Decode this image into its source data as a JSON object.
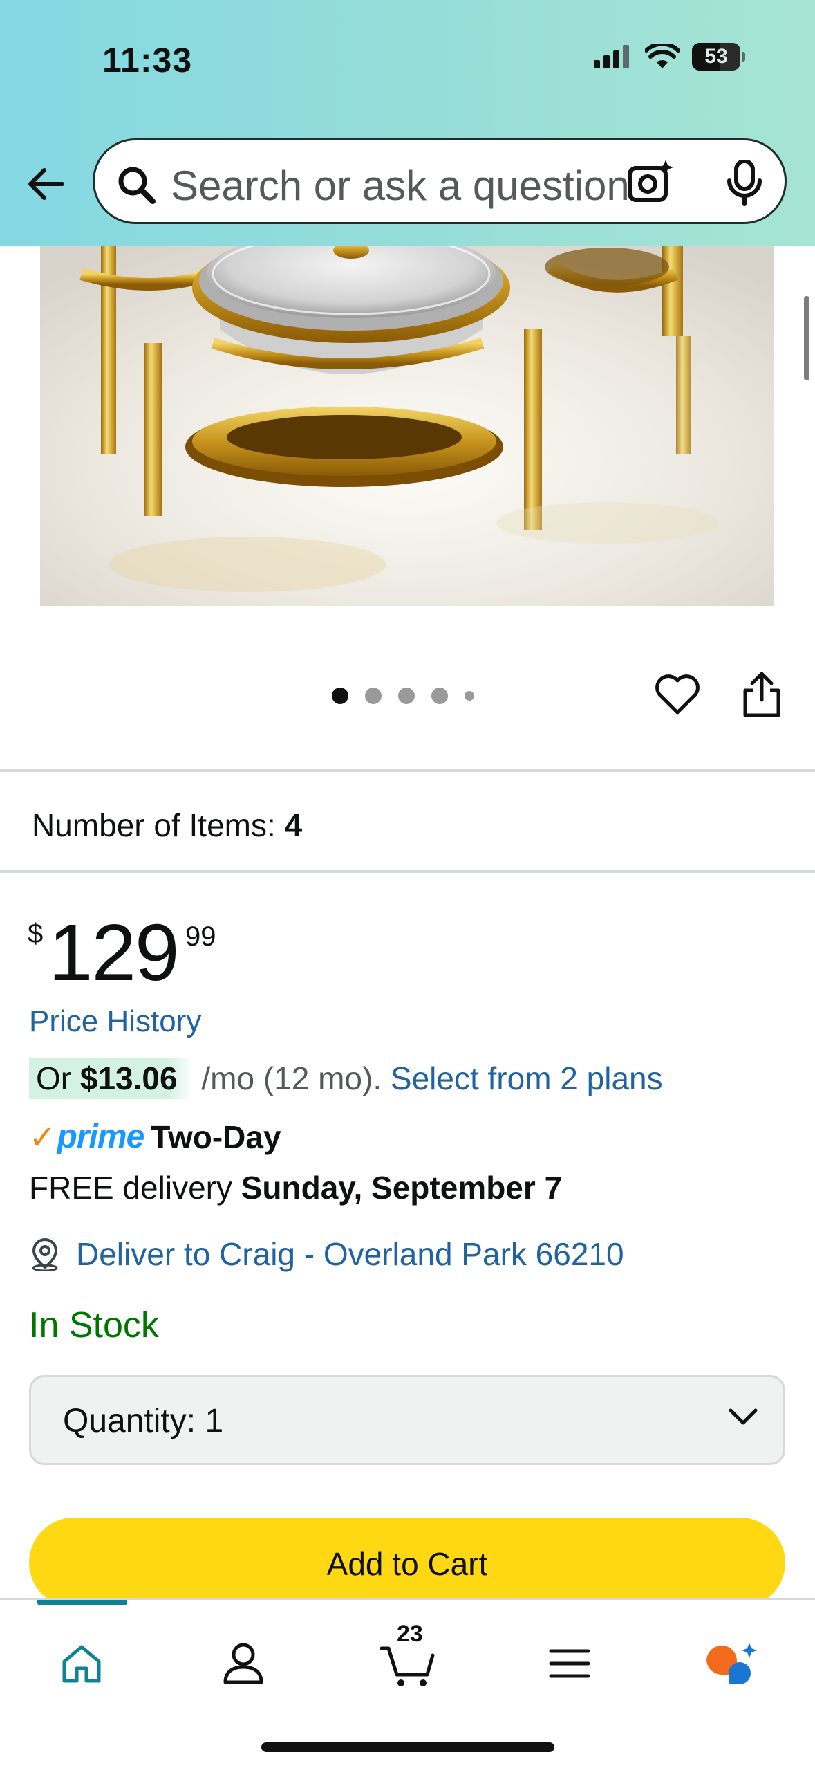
{
  "status_bar": {
    "time": "11:33",
    "battery": "53"
  },
  "search": {
    "placeholder": "Search or ask a question"
  },
  "gallery": {
    "image_count": 5,
    "active_index": 0
  },
  "product": {
    "items_label": "Number of Items:",
    "items_value": "4",
    "price_symbol": "$",
    "price_whole": "129",
    "price_fraction": "99",
    "price_history": "Price History",
    "monthly_prefix": "Or ",
    "monthly_amount": "$13.06",
    "monthly_suffix": " /mo (12 mo). ",
    "monthly_link": "Select from 2 plans",
    "prime_check": "✓",
    "prime_label": "prime",
    "prime_speed": "Two-Day",
    "delivery_prefix": "FREE delivery ",
    "delivery_date": "Sunday, September 7",
    "deliver_to": "Deliver to Craig - Overland Park 66210",
    "stock": "In Stock",
    "quantity_label": "Quantity:",
    "quantity_value": "1",
    "add_to_cart": "Add to Cart"
  },
  "nav": {
    "cart_count": "23"
  },
  "colors": {
    "link": "#2162a1",
    "in_stock": "#007600",
    "add_to_cart": "#ffd814",
    "prime_blue": "#1a98ff",
    "nav_active": "#0f8295"
  }
}
